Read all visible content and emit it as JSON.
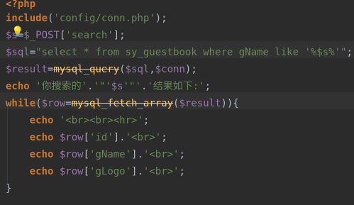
{
  "editor": {
    "lines": [
      {
        "segments": [
          {
            "text": "<?php",
            "cls": "kw"
          }
        ]
      },
      {
        "segments": [
          {
            "text": "include",
            "cls": "kw"
          },
          {
            "text": "(",
            "cls": "plain"
          },
          {
            "text": "'config/conn.php'",
            "cls": "str"
          },
          {
            "text": ");",
            "cls": "plain"
          }
        ]
      },
      {
        "segments": [
          {
            "text": "$s",
            "cls": "var"
          },
          {
            "text": "=",
            "cls": "plain"
          },
          {
            "text": "$_POST",
            "cls": "var"
          },
          {
            "text": "[",
            "cls": "plain"
          },
          {
            "text": "'search'",
            "cls": "str"
          },
          {
            "text": "];",
            "cls": "plain"
          }
        ]
      },
      {
        "segments": [
          {
            "text": "$sql",
            "cls": "var"
          },
          {
            "text": "=",
            "cls": "plain"
          },
          {
            "text": "\"select * from sy_guestbook where gName like '%$s%'\"",
            "cls": "str"
          },
          {
            "text": ";",
            "cls": "plain"
          }
        ]
      },
      {
        "segments": [
          {
            "text": "$result",
            "cls": "var"
          },
          {
            "text": "=",
            "cls": "plain"
          },
          {
            "text": "mysql_query",
            "cls": "fn depr"
          },
          {
            "text": "(",
            "cls": "plain"
          },
          {
            "text": "$sql",
            "cls": "var"
          },
          {
            "text": ",",
            "cls": "plain"
          },
          {
            "text": "$conn",
            "cls": "var"
          },
          {
            "text": ");",
            "cls": "plain"
          }
        ]
      },
      {
        "segments": [
          {
            "text": "echo",
            "cls": "kw"
          },
          {
            "text": " ",
            "cls": "plain"
          },
          {
            "text": "'你搜索的'",
            "cls": "str"
          },
          {
            "text": ".",
            "cls": "plain"
          },
          {
            "text": "'\"'",
            "cls": "str"
          },
          {
            "text": "$s",
            "cls": "var"
          },
          {
            "text": "'\"'",
            "cls": "str"
          },
          {
            "text": ".",
            "cls": "plain"
          },
          {
            "text": "'结果如下:'",
            "cls": "str"
          },
          {
            "text": ";",
            "cls": "plain"
          }
        ]
      },
      {
        "segments": [
          {
            "text": "while",
            "cls": "kw"
          },
          {
            "text": "(",
            "cls": "plain"
          },
          {
            "text": "$row",
            "cls": "var"
          },
          {
            "text": "=",
            "cls": "plain"
          },
          {
            "text": "mysql_fetch_array",
            "cls": "fn depr"
          },
          {
            "text": "(",
            "cls": "plain"
          },
          {
            "text": "$result",
            "cls": "var"
          },
          {
            "text": ")){",
            "cls": "plain"
          }
        ]
      },
      {
        "segments": [
          {
            "text": "    ",
            "cls": "plain"
          },
          {
            "text": "echo",
            "cls": "kw"
          },
          {
            "text": " ",
            "cls": "plain"
          },
          {
            "text": "'<br><br><hr>'",
            "cls": "str"
          },
          {
            "text": ";",
            "cls": "plain"
          }
        ]
      },
      {
        "segments": [
          {
            "text": "    ",
            "cls": "plain"
          },
          {
            "text": "echo",
            "cls": "kw"
          },
          {
            "text": " ",
            "cls": "plain"
          },
          {
            "text": "$row",
            "cls": "var"
          },
          {
            "text": "[",
            "cls": "plain"
          },
          {
            "text": "'id'",
            "cls": "str"
          },
          {
            "text": "].",
            "cls": "plain"
          },
          {
            "text": "'<br>'",
            "cls": "str"
          },
          {
            "text": ";",
            "cls": "plain"
          }
        ]
      },
      {
        "segments": [
          {
            "text": "    ",
            "cls": "plain"
          },
          {
            "text": "echo",
            "cls": "kw"
          },
          {
            "text": " ",
            "cls": "plain"
          },
          {
            "text": "$row",
            "cls": "var"
          },
          {
            "text": "[",
            "cls": "plain"
          },
          {
            "text": "'gName'",
            "cls": "str"
          },
          {
            "text": "].",
            "cls": "plain"
          },
          {
            "text": "'<br>'",
            "cls": "str"
          },
          {
            "text": ";",
            "cls": "plain"
          }
        ]
      },
      {
        "segments": [
          {
            "text": "    ",
            "cls": "plain"
          },
          {
            "text": "echo",
            "cls": "kw"
          },
          {
            "text": " ",
            "cls": "plain"
          },
          {
            "text": "$row",
            "cls": "var"
          },
          {
            "text": "[",
            "cls": "plain"
          },
          {
            "text": "'gLogo'",
            "cls": "str"
          },
          {
            "text": "].",
            "cls": "plain"
          },
          {
            "text": "'<br>'",
            "cls": "str"
          },
          {
            "text": ";",
            "cls": "plain"
          }
        ]
      },
      {
        "segments": [
          {
            "text": "}",
            "cls": "plain"
          }
        ]
      }
    ],
    "intention_icon": "lightbulb-icon",
    "colors": {
      "background": "#2b2b2b",
      "keyword": "#cc7832",
      "string": "#6a8759",
      "variable": "#9876aa",
      "function": "#ffc66d",
      "plain": "#a9b7c6"
    }
  }
}
